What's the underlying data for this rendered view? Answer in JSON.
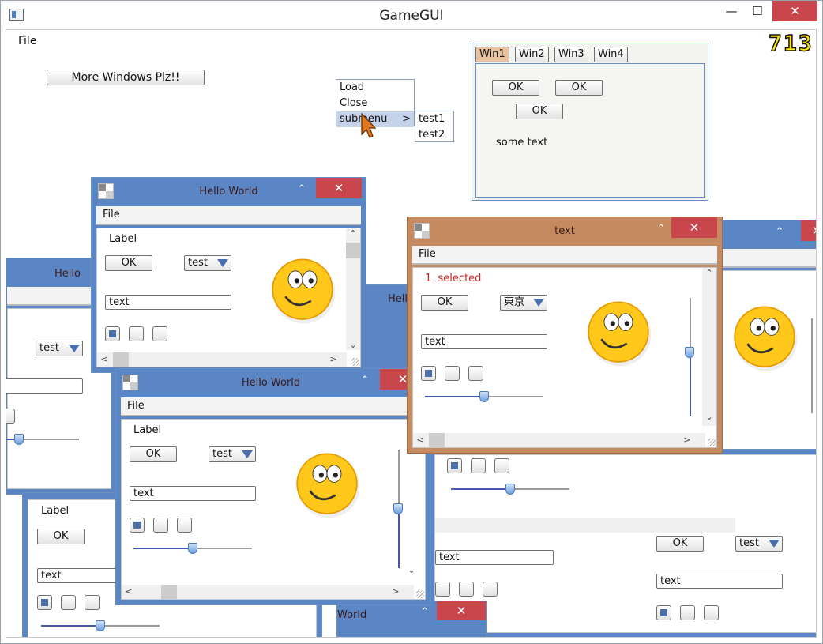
{
  "host": {
    "title": "GameGUI",
    "menu_file": "File",
    "fps": "713",
    "minimize": "—",
    "maximize": "☐",
    "close": "✕"
  },
  "main": {
    "more_windows_button": "More Windows Plz!!"
  },
  "context_menu": {
    "items": [
      "Load",
      "Close",
      "submenu"
    ],
    "submenu_items": [
      "test1",
      "test2"
    ]
  },
  "tab_window": {
    "tabs": [
      "Win1",
      "Win2",
      "Win3",
      "Win4"
    ],
    "selected_tab": "Win1",
    "ok_labels": [
      "OK",
      "OK",
      "OK"
    ],
    "text": "some text"
  },
  "hello_world_1": {
    "title": "Hello World",
    "menu_file": "File",
    "label": "Label",
    "ok": "OK",
    "combo": "test",
    "input": "text"
  },
  "hello_world_2": {
    "title": "Hello World",
    "menu_file": "File",
    "label": "Label",
    "ok": "OK",
    "combo": "test",
    "input": "text",
    "slider_fraction": 0.5,
    "vslider_fraction": 0.5
  },
  "text_window": {
    "title": "text",
    "menu_file": "File",
    "selected_text": "1  selected",
    "ok": "OK",
    "combo": "東京",
    "input": "text",
    "slider_fraction": 0.5,
    "vslider_fraction": 0.55,
    "accent_color": "#d02020"
  },
  "background_windows": {
    "title_left": "Hello",
    "title_mid": "Hello",
    "title_bottom": "World",
    "combo": "test",
    "label": "Label",
    "ok": "OK",
    "input": "text"
  },
  "colors": {
    "title_blue": "#5b86c5",
    "title_brown": "#c58a60",
    "close_red": "#c9474c",
    "fps_yellow": "#ffe800"
  }
}
